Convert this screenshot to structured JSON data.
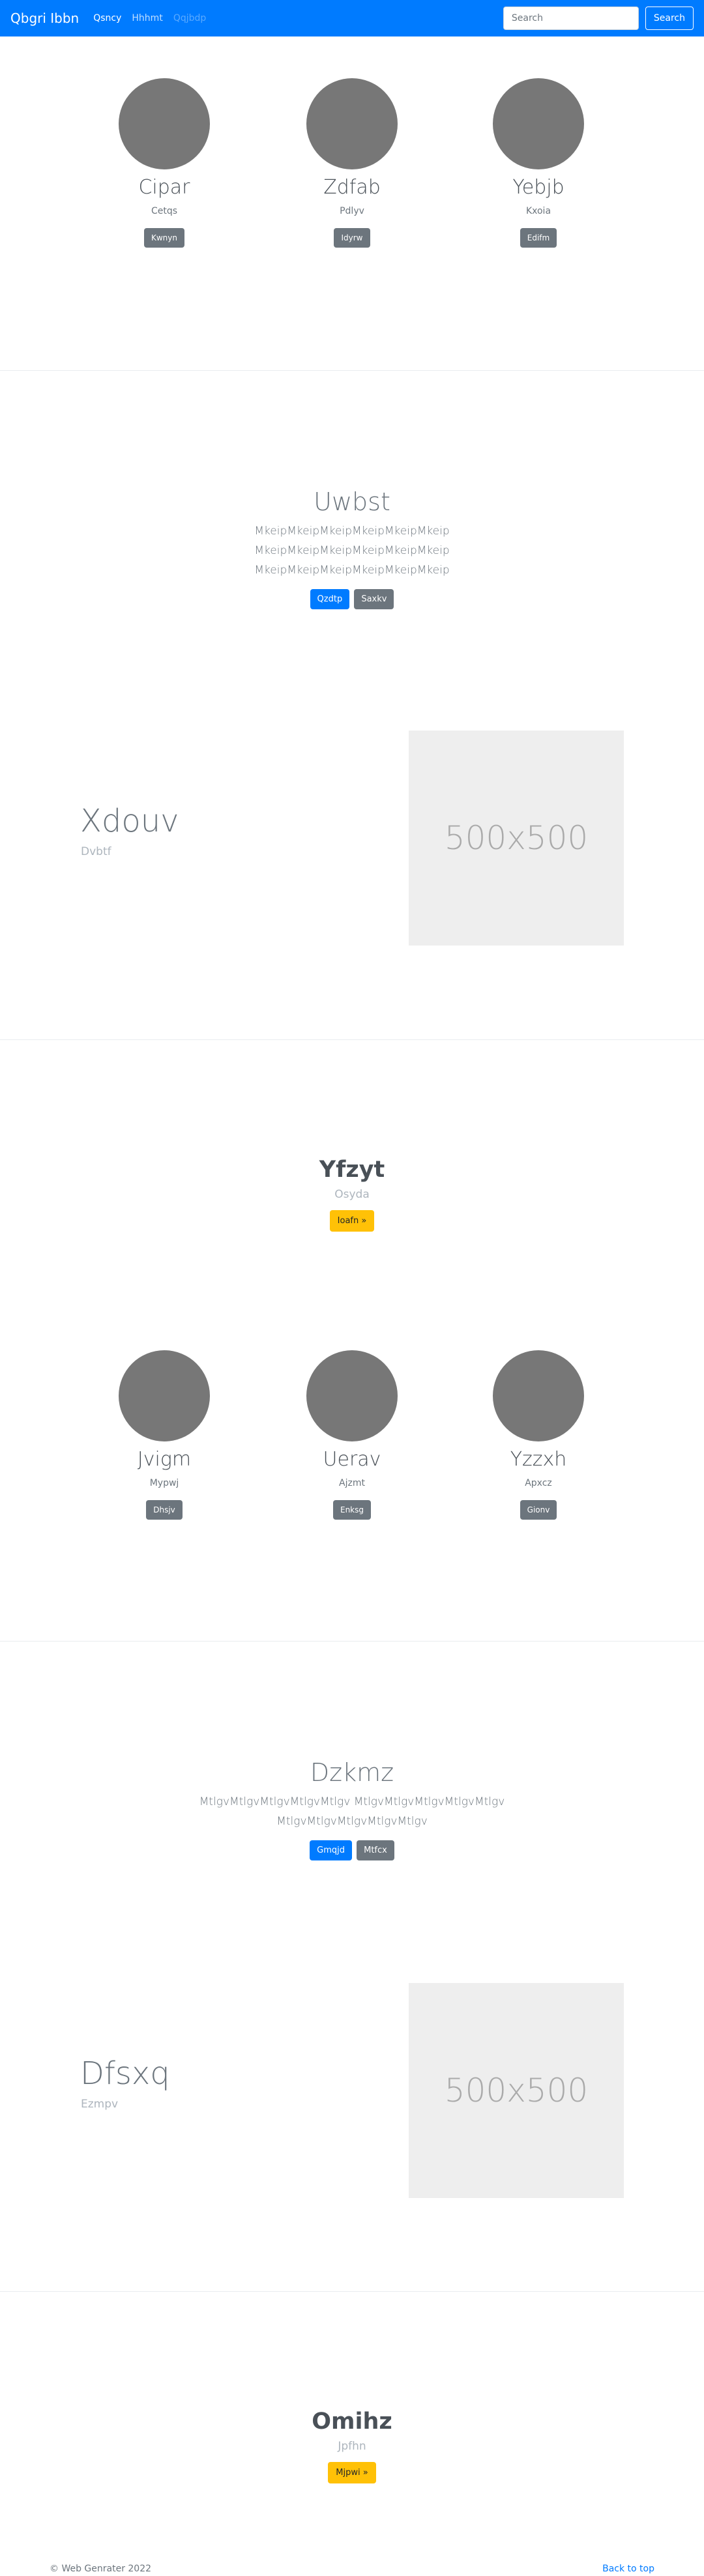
{
  "navbar": {
    "brand": "Qbgri Ibbn",
    "links": [
      "Qsncy",
      "Hhhmt",
      "Qqjbdp"
    ],
    "search_placeholder": "Search",
    "search_button": "Search"
  },
  "profiles_1": [
    {
      "name": "Cipar",
      "sub": "Cetqs",
      "button": "Kwnyn"
    },
    {
      "name": "Zdfab",
      "sub": "Pdlyv",
      "button": "Idyrw"
    },
    {
      "name": "Yebjb",
      "sub": "Kxoia",
      "button": "Edifm"
    }
  ],
  "jumbo_1": {
    "title": "Uwbst",
    "lines": [
      "MkeipMkeipMkeipMkeipMkeipMkeip",
      "MkeipMkeipMkeipMkeipMkeipMkeip",
      "MkeipMkeipMkeipMkeipMkeipMkeip"
    ],
    "primary": "Qzdtp",
    "secondary": "Saxkv"
  },
  "feature_1": {
    "title": "Xdouv",
    "sub": "Dvbtf",
    "image_label": "500x500"
  },
  "album_1": {
    "title": "Yfzyt",
    "sub": "Osyda",
    "button": "Ioafn »"
  },
  "profiles_2": [
    {
      "name": "Jvigm",
      "sub": "Mypwj",
      "button": "Dhsjv"
    },
    {
      "name": "Uerav",
      "sub": "Ajzmt",
      "button": "Enksg"
    },
    {
      "name": "Yzzxh",
      "sub": "Apxcz",
      "button": "Gionv"
    }
  ],
  "jumbo_2": {
    "title": "Dzkmz",
    "lines": [
      "MtlgvMtlgvMtlgvMtlgvMtlgv MtlgvMtlgvMtlgvMtlgvMtlgv",
      "MtlgvMtlgvMtlgvMtlgvMtlgv"
    ],
    "primary": "Gmqjd",
    "secondary": "Mtfcx"
  },
  "feature_2": {
    "title": "Dfsxq",
    "sub": "Ezmpv",
    "image_label": "500x500"
  },
  "album_2": {
    "title": "Omihz",
    "sub": "Jpfhn",
    "button": "Mjpwi »"
  },
  "footer": {
    "copyright": "© Web Genrater 2022",
    "back_to_top": "Back to top"
  }
}
